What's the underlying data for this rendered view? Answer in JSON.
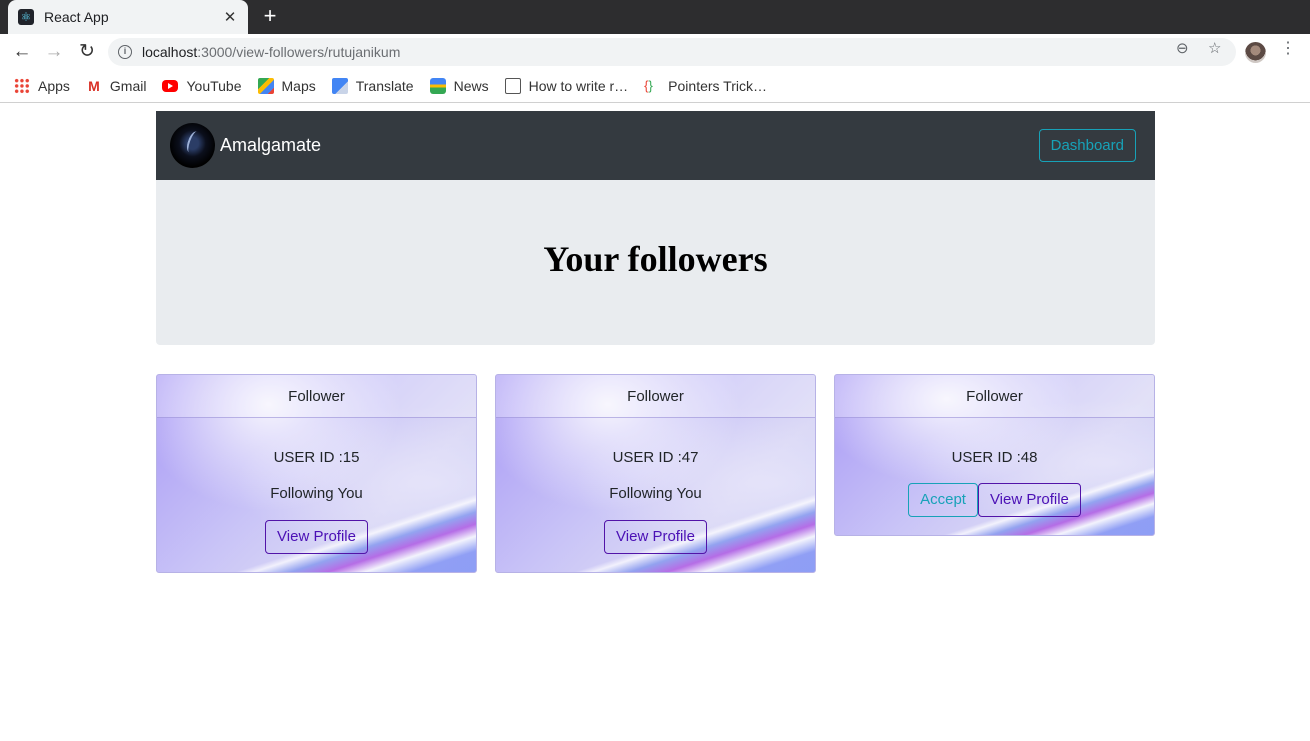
{
  "browser": {
    "tab_title": "React App",
    "tab_close": "✕",
    "new_tab": "+",
    "url_host": "localhost",
    "url_path": ":3000/view-followers/rutujanikum",
    "bookmarks": [
      {
        "label": "Apps",
        "icon": "apps-grid-icon"
      },
      {
        "label": "Gmail",
        "icon": "gmail-icon"
      },
      {
        "label": "YouTube",
        "icon": "youtube-icon"
      },
      {
        "label": "Maps",
        "icon": "maps-icon"
      },
      {
        "label": "Translate",
        "icon": "translate-icon"
      },
      {
        "label": "News",
        "icon": "news-icon"
      },
      {
        "label": "How to write r…",
        "icon": "terminal-icon"
      },
      {
        "label": "Pointers Trick…",
        "icon": "braces-icon"
      }
    ]
  },
  "navbar": {
    "brand": "Amalgamate",
    "dashboard_label": "Dashboard"
  },
  "hero": {
    "title": "Your followers"
  },
  "cards": [
    {
      "header": "Follower",
      "user_id": "USER ID :15",
      "status": "Following You",
      "view_label": "View Profile"
    },
    {
      "header": "Follower",
      "user_id": "USER ID :47",
      "status": "Following You",
      "view_label": "View Profile"
    },
    {
      "header": "Follower",
      "user_id": "USER ID :48",
      "accept_label": "Accept",
      "view_label": "View Profile"
    }
  ],
  "colors": {
    "navbar_bg": "#343a40",
    "info_accent": "#17a2b8",
    "purple_button": "#5214a8",
    "jumbotron_bg": "#e9ecef"
  }
}
